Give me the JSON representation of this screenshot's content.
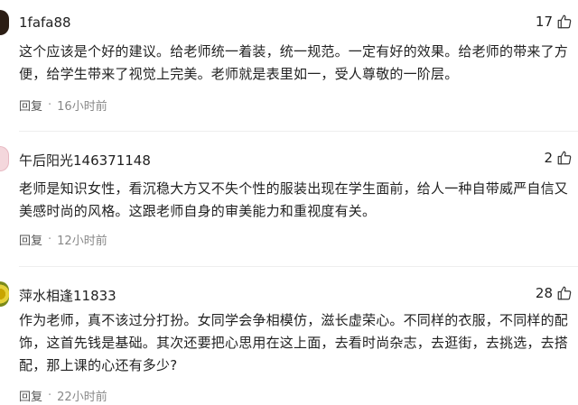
{
  "comments": [
    {
      "username": "1fafa88",
      "likes": "17",
      "text": "这个应该是个好的建议。给老师统一着装，统一规范。一定有好的效果。给老师的带来了方便，给学生带来了视觉上完美。老师就是表里如一，受人尊敬的一阶层。",
      "reply_label": "回复",
      "separator": "·",
      "time": "16小时前"
    },
    {
      "username": "午后阳光146371148",
      "likes": "2",
      "text": "老师是知识女性，看沉稳大方又不失个性的服装出现在学生面前，给人一种自带威严自信又美感时尚的风格。这跟老师自身的审美能力和重视度有关。",
      "reply_label": "回复",
      "separator": "·",
      "time": "12小时前"
    },
    {
      "username": "萍水相逢11833",
      "likes": "28",
      "text": "作为老师，真不该过分打扮。女同学会争相模仿，滋长虚荣心。不同样的衣服，不同样的配饰，这首先钱是基础。其次还要把心思用在这上面，去看时尚杂志，去逛街，去挑选，去搭配，那上课的心还有多少?",
      "reply_label": "回复",
      "separator": "·",
      "time": "22小时前"
    }
  ],
  "colors": {
    "text": "#222222",
    "meta": "#888888",
    "divider": "#eeeeee"
  },
  "icons": {
    "like": "thumbs-up-icon"
  }
}
